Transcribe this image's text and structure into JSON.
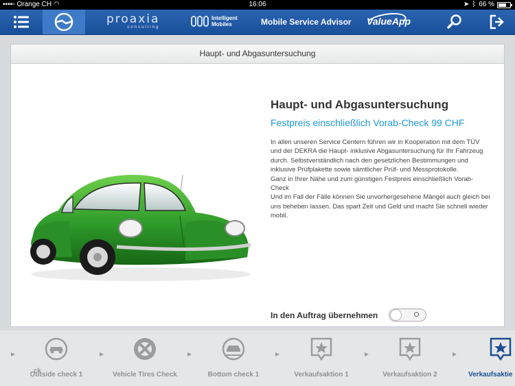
{
  "status_bar": {
    "carrier": "Orange CH",
    "time": "16:06",
    "battery": "66 %"
  },
  "navbar": {
    "brand_proaxia": "proaxia",
    "brand_proaxia_sub": "consulting",
    "brand_im_line1": "Intelligent",
    "brand_im_line2": "Mobiles",
    "title": "Mobile Service Advisor",
    "brand_valueapp": "ValueApp"
  },
  "card": {
    "header": "Haupt- und Abgasuntersuchung",
    "title": "Haupt- und Abgasuntersuchung",
    "price": "Festpreis einschließlich Vorab-Check 99 CHF",
    "description": [
      "In allen unseren Service Centern führen wir in Kooperation mit dem TÜV und der DEKRA die Haupt- inklusive Abgasuntersuchung für Ihr Fahrzeug durch. Selbstverständlich nach den gesetzlichen Bestimmungen und inklusive Prüfplakette sowie sämtlicher Prüf- und Messprotokolle.",
      "Ganz in Ihrer Nähe und zum günstigen Festpreis einschließlich Vorab-Check",
      "Und im Fall der Fälle können Sie unvorhergesehene Mängel auch gleich bei uns beheben lassen. Das spart Zeit und Geld und macht Sie schnell wieder mobil."
    ],
    "order_label": "In den Auftrag übernehmen",
    "order_toggle_on": false,
    "car_color": "#2e9a2a"
  },
  "steps": [
    {
      "label": "ck"
    },
    {
      "label": "Outside check 1"
    },
    {
      "label": "Vehicle Tires Check"
    },
    {
      "label": "Bottom check 1"
    },
    {
      "label": "Verkaufsaktion 1"
    },
    {
      "label": "Verkaufsaktion 2"
    },
    {
      "label": "Verkaufsaktie"
    }
  ],
  "colors": {
    "nav": "#1f57a4",
    "accent": "#1d9ad8",
    "active_step": "#1d4e8f"
  }
}
